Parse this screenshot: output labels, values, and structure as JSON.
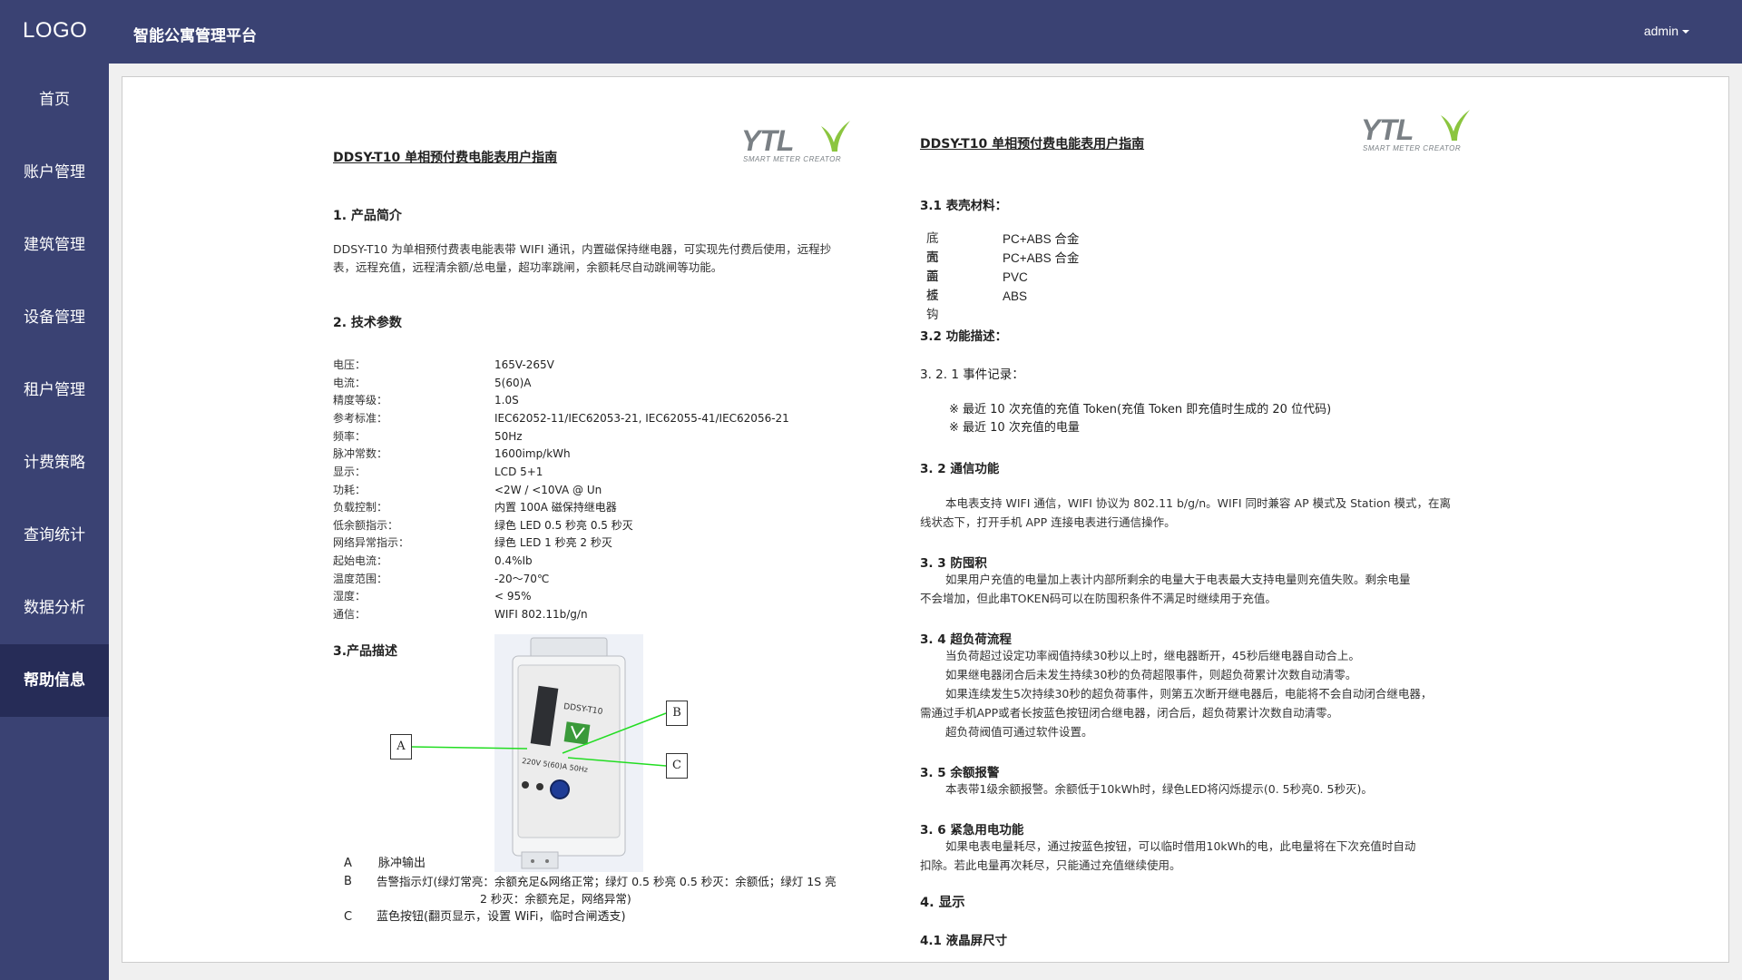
{
  "header": {
    "logo": "LOGO",
    "title": "智能公寓管理平台",
    "user": "admin"
  },
  "sidebar": {
    "items": [
      {
        "label": "首页"
      },
      {
        "label": "账户管理"
      },
      {
        "label": "建筑管理"
      },
      {
        "label": "设备管理"
      },
      {
        "label": "租户管理"
      },
      {
        "label": "计费策略"
      },
      {
        "label": "查询统计"
      },
      {
        "label": "数据分析"
      },
      {
        "label": "帮助信息"
      }
    ],
    "active_index": 8
  },
  "doc": {
    "left": {
      "title": "DDSY-T10 单相预付费电能表用户指南",
      "logo_text": "YTL",
      "logo_sub": "SMART METER CREATOR",
      "s1_title": "1. 产品简介",
      "s1_line1": "DDSY-T10 为单相预付费表电能表带 WIFI 通讯，内置磁保持继电器，可实现先付费后使用，远程抄",
      "s1_line2": "表，远程充值，远程清余额/总电量，超功率跳闸，余额耗尽自动跳闸等功能。",
      "s2_title": "2. 技术参数",
      "specs": [
        {
          "label": "电压：",
          "value": "165V-265V"
        },
        {
          "label": "电流：",
          "value": "5(60)A"
        },
        {
          "label": "精度等级：",
          "value": "1.0S"
        },
        {
          "label": "参考标准：",
          "value": "IEC62052-11/IEC62053-21, IEC62055-41/IEC62056-21"
        },
        {
          "label": "频率：",
          "value": "50Hz"
        },
        {
          "label": "脉冲常数：",
          "value": "1600imp/kWh"
        },
        {
          "label": "显示：",
          "value": "LCD 5+1"
        },
        {
          "label": "功耗：",
          "value": "<2W / <10VA @ Un"
        },
        {
          "label": "负载控制：",
          "value": "内置 100A 磁保持继电器"
        },
        {
          "label": "低余额指示：",
          "value": "绿色 LED 0.5 秒亮 0.5 秒灭"
        },
        {
          "label": "网络异常指示：",
          "value": "绿色 LED 1 秒亮 2 秒灭"
        },
        {
          "label": "起始电流：",
          "value": "0.4%Ib"
        },
        {
          "label": "温度范围：",
          "value": "-20～70℃"
        },
        {
          "label": "湿度：",
          "value": "< 95%"
        },
        {
          "label": "通信：",
          "value": "WIFI    802.11b/g/n"
        }
      ],
      "s3_title": "3.产品描述",
      "device_label": "DDSY-T10",
      "device_rating": "220V  5(60)A  50Hz",
      "callouts": [
        "A",
        "B",
        "C"
      ],
      "legend": [
        {
          "key": "A",
          "text": "脉冲输出"
        },
        {
          "key": "B",
          "text": "告警指示灯(绿灯常亮：余额充足&网络正常；绿灯 0.5 秒亮 0.5 秒灭：余额低；绿灯 1S 亮"
        },
        {
          "key": "",
          "text": "2 秒灭：余额充足，网络异常)"
        },
        {
          "key": "C",
          "text": "蓝色按钮(翻页显示，设置 WiFi，临时合闸透支)"
        }
      ]
    },
    "right": {
      "title": "DDSY-T10 单相预付费电能表用户指南",
      "logo_text": "YTL",
      "logo_sub": "SMART METER CREATOR",
      "s31_title": "3.1 表壳材料：",
      "materials": [
        {
          "label": "底壳",
          "value": "PC+ABS 合金"
        },
        {
          "label": "面盖",
          "value": "PC+ABS 合金"
        },
        {
          "label": "面板",
          "value": "PVC"
        },
        {
          "label": "挂钩",
          "value": "ABS"
        }
      ],
      "s32_title": "3.2  功能描述：",
      "s321_title": "3. 2. 1 事件记录：",
      "events": [
        "※  最近 10 次充值的充值 Token(充值 Token 即充值时生成的 20 位代码)",
        "※  最近 10 次充值的电量"
      ],
      "s32b_title": "3. 2  通信功能",
      "comm_line1": "本电表支持 WIFI 通信，WIFI 协议为 802.11 b/g/n。WIFI 同时兼容 AP 模式及 Station 模式，在离",
      "comm_line2": "线状态下，打开手机 APP 连接电表进行通信操作。",
      "s33_title": "3. 3  防囤积",
      "hoard_line1": "如果用户充值的电量加上表计内部所剩余的电量大于电表最大支持电量则充值失败。剩余电量",
      "hoard_line2": "不会增加，但此串TOKEN码可以在防囤积条件不满足时继续用于充值。",
      "s34_title": "3. 4  超负荷流程",
      "overload_lines": [
        "当负荷超过设定功率阀值持续30秒以上时，继电器断开，45秒后继电器自动合上。",
        "如果继电器闭合后未发生持续30秒的负荷超限事件，则超负荷累计次数自动清零。",
        "如果连续发生5次持续30秒的超负荷事件，则第五次断开继电器后，电能将不会自动闭合继电器，",
        "需通过手机APP或者长按蓝色按钮闭合继电器，闭合后，超负荷累计次数自动清零。",
        "超负荷阀值可通过软件设置。"
      ],
      "s35_title": "3. 5  余额报警",
      "alarm_line": "本表带1级余额报警。余额低于10kWh时，绿色LED将闪烁提示(0. 5秒亮0. 5秒灭)。",
      "s36_title": "3. 6  紧急用电功能",
      "emerg_line1": "如果电表电量耗尽，通过按蓝色按钮，可以临时借用10kWh的电，此电量将在下次充值时自动",
      "emerg_line2": "扣除。若此电量再次耗尽，只能通过充值继续使用。",
      "s4_title": "4.    显示",
      "s41_title": "4.1  液晶屏尺寸"
    }
  },
  "colors": {
    "nav_bg": "#3a4273",
    "nav_active": "#262c57",
    "logo_green": "#8bc53f",
    "logo_gray": "#7a8085",
    "callout_line": "#22dd22"
  }
}
